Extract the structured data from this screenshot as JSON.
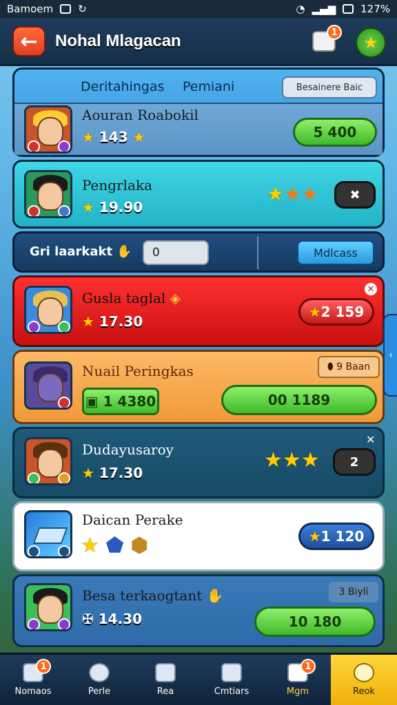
{
  "statusbar": {
    "left_text": "Bamoem",
    "right_text": "127%"
  },
  "header": {
    "title": "Nohal Mlagacan",
    "chat_badge": "1"
  },
  "rank_header": {
    "tab_left": "Deritahingas",
    "tab_right": "Pemiani",
    "button": "Besainere Baic"
  },
  "rows": [
    {
      "name": "Aouran Roabokil",
      "score": "143",
      "pill": "5 400"
    },
    {
      "name": "Pengrlaka",
      "score": "19.90",
      "pill": "✖"
    },
    {
      "name": "Gusla taglal",
      "score": "17.30",
      "pill": "2 159"
    },
    {
      "name": "Nuail Peringkas",
      "score": "1 4380",
      "pill": "00    1189",
      "tag": "9 Baan"
    },
    {
      "name": "Dudayusaroy",
      "score": "17.30",
      "pill": "2"
    },
    {
      "name": "Daican Perake",
      "pill": "1 120"
    },
    {
      "name": "Besa terkaogtant",
      "score": "14.30",
      "pill": "10    180",
      "tag": "3 Biyli"
    }
  ],
  "search": {
    "label": "Gri laarkakt",
    "value": "0",
    "button": "Mdlcass"
  },
  "nav": {
    "items": [
      {
        "label": "Nomaos",
        "badge": "1"
      },
      {
        "label": "Perle"
      },
      {
        "label": "Rea"
      },
      {
        "label": "Cmtiars"
      },
      {
        "label": "Mgm",
        "badge": "1"
      },
      {
        "label": "Reok"
      }
    ]
  },
  "colors": {
    "accent": "#ffd53a",
    "header": "#1f3b5a",
    "highlight_row": "#e01818"
  }
}
